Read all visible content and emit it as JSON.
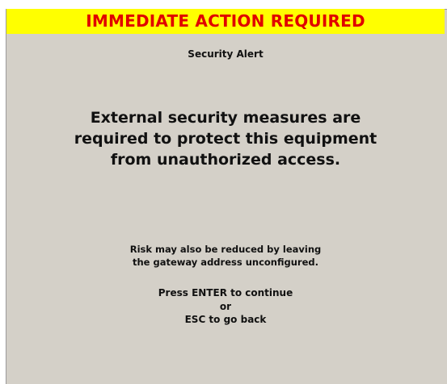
{
  "alert": {
    "banner": "IMMEDIATE ACTION REQUIRED",
    "subtitle": "Security Alert",
    "message_lines": [
      "External security measures are",
      "required to protect this equipment",
      "from unauthorized access."
    ],
    "risk_lines": [
      "Risk may also be reduced by leaving",
      "the gateway address unconfigured."
    ],
    "prompt": {
      "continue": "Press ENTER to continue",
      "or": "or",
      "back": "ESC to go back"
    }
  },
  "colors": {
    "banner_bg": "#ffff00",
    "banner_text": "#e00000",
    "screen_bg": "#d4d0c8"
  }
}
